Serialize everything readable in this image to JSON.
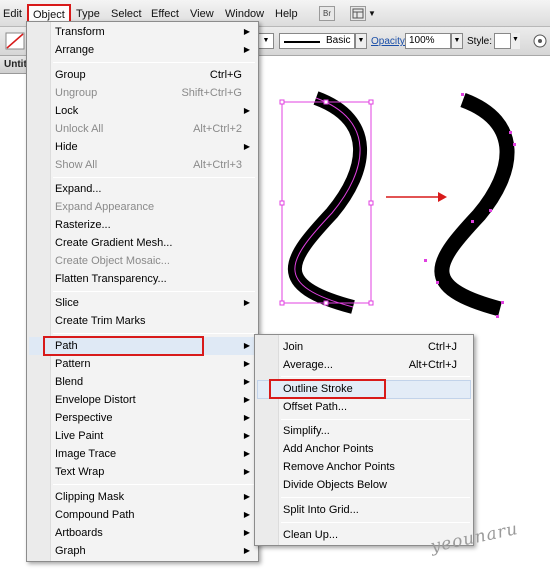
{
  "menubar": {
    "items": [
      "Edit",
      "Object",
      "Type",
      "Select",
      "Effect",
      "View",
      "Window",
      "Help"
    ],
    "br_icon": "Br"
  },
  "control_bar": {
    "stroke_style": "Basic",
    "opacity_label": "Opacity:",
    "opacity_value": "100%",
    "style_label": "Style:"
  },
  "document_tab": "Untitl",
  "object_menu": {
    "items": [
      {
        "label": "Transform",
        "submenu": true
      },
      {
        "label": "Arrange",
        "submenu": true
      },
      {
        "label": "Group",
        "shortcut": "Ctrl+G"
      },
      {
        "label": "Ungroup",
        "shortcut": "Shift+Ctrl+G",
        "disabled": true
      },
      {
        "label": "Lock",
        "submenu": true
      },
      {
        "label": "Unlock All",
        "shortcut": "Alt+Ctrl+2",
        "disabled": true
      },
      {
        "label": "Hide",
        "submenu": true
      },
      {
        "label": "Show All",
        "shortcut": "Alt+Ctrl+3",
        "disabled": true
      },
      {
        "label": "Expand..."
      },
      {
        "label": "Expand Appearance",
        "disabled": true
      },
      {
        "label": "Rasterize..."
      },
      {
        "label": "Create Gradient Mesh..."
      },
      {
        "label": "Create Object Mosaic...",
        "disabled": true
      },
      {
        "label": "Flatten Transparency..."
      },
      {
        "label": "Slice",
        "submenu": true
      },
      {
        "label": "Create Trim Marks"
      },
      {
        "label": "Path",
        "submenu": true,
        "highlighted": true
      },
      {
        "label": "Pattern",
        "submenu": true
      },
      {
        "label": "Blend",
        "submenu": true
      },
      {
        "label": "Envelope Distort",
        "submenu": true
      },
      {
        "label": "Perspective",
        "submenu": true
      },
      {
        "label": "Live Paint",
        "submenu": true
      },
      {
        "label": "Image Trace",
        "submenu": true
      },
      {
        "label": "Text Wrap",
        "submenu": true
      },
      {
        "label": "Clipping Mask",
        "submenu": true
      },
      {
        "label": "Compound Path",
        "submenu": true
      },
      {
        "label": "Artboards",
        "submenu": true
      },
      {
        "label": "Graph",
        "submenu": true
      }
    ]
  },
  "path_menu": {
    "items": [
      {
        "label": "Join",
        "shortcut": "Ctrl+J"
      },
      {
        "label": "Average...",
        "shortcut": "Alt+Ctrl+J"
      },
      {
        "label": "Outline Stroke",
        "highlighted": true
      },
      {
        "label": "Offset Path..."
      },
      {
        "label": "Simplify..."
      },
      {
        "label": "Add Anchor Points"
      },
      {
        "label": "Remove Anchor Points"
      },
      {
        "label": "Divide Objects Below"
      },
      {
        "label": "Split Into Grid..."
      },
      {
        "label": "Clean Up..."
      }
    ]
  },
  "watermark": "yeounaru",
  "colors": {
    "highlight_box": "#d81a1a",
    "selection": "#e040e0",
    "arrow": "#d81a1a"
  }
}
